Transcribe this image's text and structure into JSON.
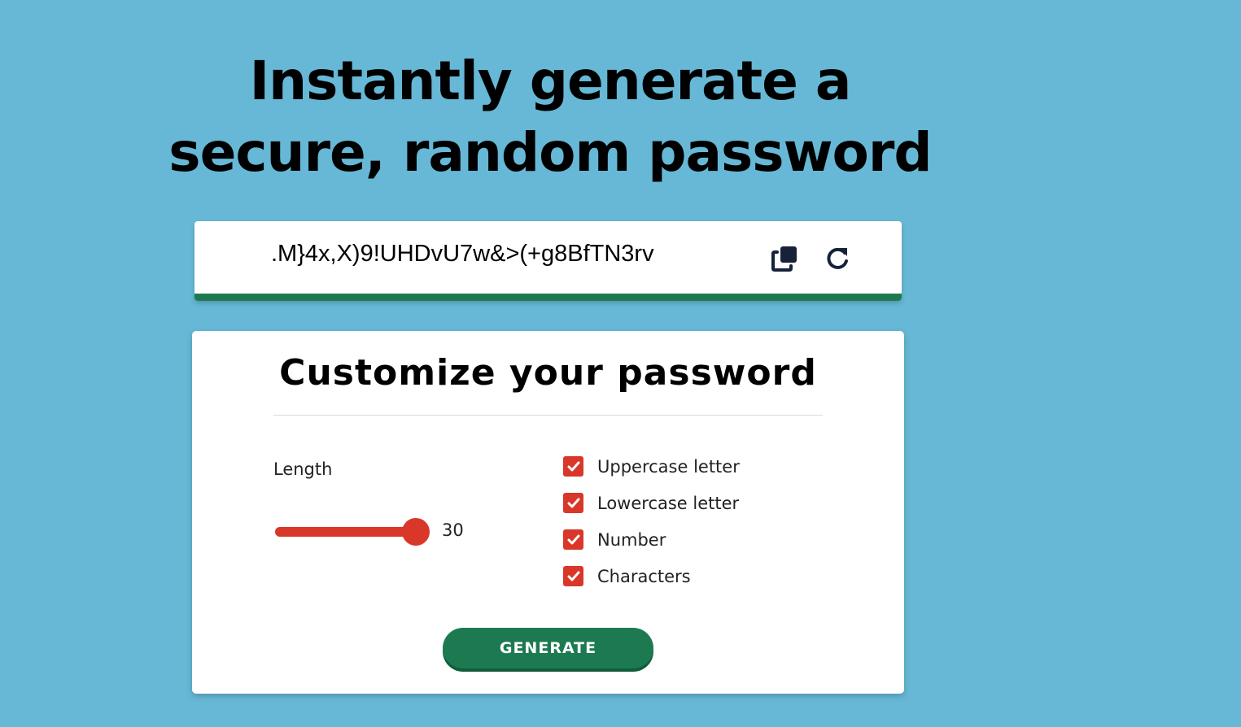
{
  "headline": "Instantly generate a secure, random password",
  "password": {
    "value": ".M}4x,X)9!UHDvU7w&>(+g8BfTN3rv",
    "copy_icon": "copy-icon",
    "refresh_icon": "refresh-icon",
    "strength_color": "#1d7a50"
  },
  "customize": {
    "title": "Customize your password",
    "length_label": "Length",
    "length": {
      "value": "30",
      "min": 1,
      "max": 30
    },
    "options": [
      {
        "label": "Uppercase letter",
        "checked": true
      },
      {
        "label": "Lowercase letter",
        "checked": true
      },
      {
        "label": "Number",
        "checked": true
      },
      {
        "label": "Characters",
        "checked": true
      }
    ],
    "generate_label": "GENERATE"
  },
  "colors": {
    "background": "#66b8d6",
    "accent": "#d9372a",
    "button": "#1d7a50"
  }
}
